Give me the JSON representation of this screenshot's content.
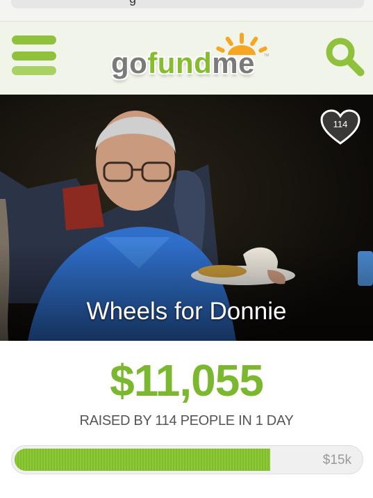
{
  "browser": {
    "url_fragment": "g"
  },
  "header": {
    "brand_part1": "go",
    "brand_part2": "fund",
    "brand_part3": "me",
    "trademark": "TM",
    "menu_icon": "hamburger-menu-icon",
    "search_icon": "search-icon",
    "colors": {
      "accent": "#86bd2e",
      "header_bg": "#f1f5e9"
    }
  },
  "campaign": {
    "title": "Wheels for Donnie",
    "hearts": "114",
    "amount": "$11,055",
    "raised_text": "RAISED BY 114 PEOPLE IN 1 DAY",
    "goal": "$15k",
    "progress_fraction": 0.737
  }
}
